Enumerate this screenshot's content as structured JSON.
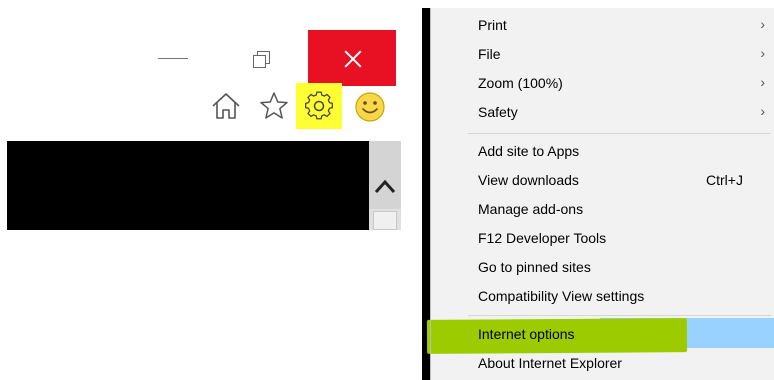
{
  "window_controls": {
    "minimize": "minimize",
    "restore": "restore",
    "close": "close"
  },
  "command_bar": {
    "icons": [
      "home-icon",
      "star-icon",
      "gear-icon",
      "smiley-icon"
    ],
    "highlight_color": "#ffff33"
  },
  "colors": {
    "close_red": "#e81123",
    "menu_bg": "#f2f2f2",
    "hover_blue": "#99d1ff",
    "marker_green": "#9ccc00"
  },
  "menu": {
    "items": [
      {
        "label": "Print",
        "submenu": true
      },
      {
        "label": "File",
        "submenu": true
      },
      {
        "label": "Zoom (100%)",
        "submenu": true
      },
      {
        "label": "Safety",
        "submenu": true
      },
      {
        "label": "Add site to Apps"
      },
      {
        "label": "View downloads",
        "shortcut": "Ctrl+J"
      },
      {
        "label": "Manage add-ons"
      },
      {
        "label": "F12 Developer Tools"
      },
      {
        "label": "Go to pinned sites"
      },
      {
        "label": "Compatibility View settings"
      },
      {
        "label": "Internet options",
        "highlighted": true
      },
      {
        "label": "About Internet Explorer"
      }
    ],
    "chevron": "›"
  }
}
